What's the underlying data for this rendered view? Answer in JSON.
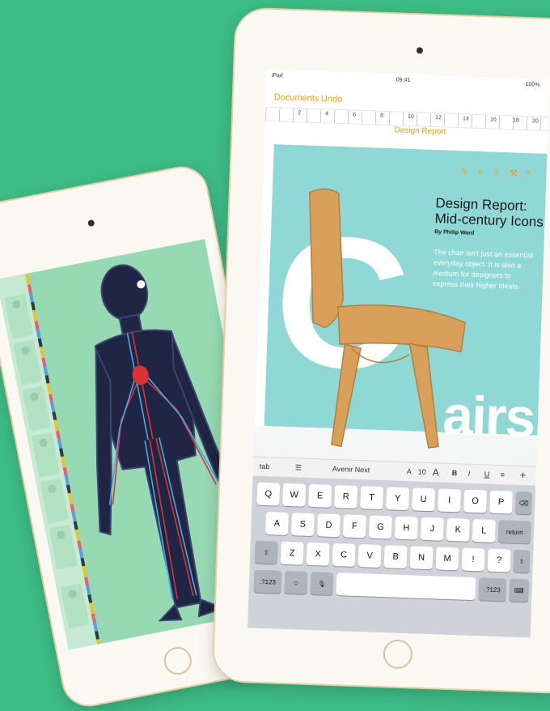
{
  "colors": {
    "background": "#3dbc86",
    "accent": "#f39c12",
    "doc_panel": "#8fd8d6"
  },
  "back_ipad": {
    "sidebar_icons": [
      "gear-icon",
      "organ-thumbnail",
      "organ-thumbnail",
      "organ-thumbnail",
      "organ-thumbnail",
      "organ-thumbnail",
      "organ-thumbnail"
    ],
    "figure": "human-circulatory-system"
  },
  "front_ipad": {
    "status": {
      "device": "iPad",
      "time": "09:41",
      "battery": "100%"
    },
    "nav": {
      "documents": "Documents",
      "undo": "Undo"
    },
    "document_title": "Design Report",
    "ruler_numbers": [
      "2",
      "4",
      "6",
      "8",
      "10",
      "12",
      "14",
      "16",
      "18",
      "20"
    ],
    "tools": [
      "brush-icon",
      "plus-icon",
      "share-icon",
      "wrench-icon",
      "help-icon"
    ],
    "doc": {
      "heading_line1": "Design Report:",
      "heading_line2": "Mid-century Icons",
      "author": "By Philip Ward",
      "blurb": "The chair isn't just an essential everyday object. It is also a medium for designers to express their higher ideals.",
      "big_letter": "C",
      "airs": "airs"
    },
    "format_bar": {
      "tab": "tab",
      "font": "Avenir Next",
      "size": "10",
      "a_small": "A",
      "a_large": "A",
      "bold": "B",
      "italic": "I",
      "underline": "U"
    },
    "keyboard": {
      "row1": [
        "Q",
        "W",
        "E",
        "R",
        "T",
        "Y",
        "U",
        "I",
        "O",
        "P"
      ],
      "row2": [
        "A",
        "S",
        "D",
        "F",
        "G",
        "H",
        "J",
        "K",
        "L"
      ],
      "row3": [
        "Z",
        "X",
        "C",
        "V",
        "B",
        "N",
        "M",
        "!",
        "?"
      ],
      "return": "return",
      "num_left": ".?123",
      "num_right": ".?123"
    }
  }
}
